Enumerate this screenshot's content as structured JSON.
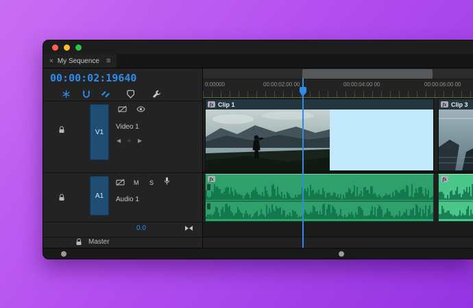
{
  "window": {
    "traffic_lights": [
      "#ff5f57",
      "#febc2e",
      "#28c840"
    ],
    "tab": {
      "close": "×",
      "title": "My Sequence",
      "menu": "≡"
    }
  },
  "transport": {
    "timecode": "00:00:02:19640"
  },
  "toolbar": {
    "icons": [
      "nest-icon",
      "snap-icon",
      "linked-selection-icon",
      "add-marker-icon",
      "timeline-settings-icon"
    ]
  },
  "ruler": {
    "labels": [
      "0:00000",
      "00:00:02:00 00",
      "00:00:04:00 00",
      "00:00:06:00 00"
    ]
  },
  "tracks": {
    "video": {
      "patch": "V1",
      "name": "Video 1"
    },
    "audio": {
      "patch": "A1",
      "name": "Audio 1",
      "mute": "M",
      "solo": "S"
    },
    "gain": "0.0",
    "master": "Master"
  },
  "keyframe_nav": {
    "prev": "◀",
    "dot": "○",
    "next": "▶"
  },
  "clips": {
    "video1": {
      "badge": "fx",
      "label": "Clip 1"
    },
    "video2": {
      "badge": "fx",
      "label": "Clip 3"
    },
    "audio1": {
      "badge": "fx"
    },
    "audio2": {
      "badge": "fx"
    }
  },
  "colors": {
    "accent": "#2d8ceb",
    "audio_green": "#2fa06c",
    "audio_green_bright": "#4cc78b",
    "waveform": "#0c6e47",
    "selection_blue": "#c3e9fc",
    "clip_header": "#24363f"
  }
}
